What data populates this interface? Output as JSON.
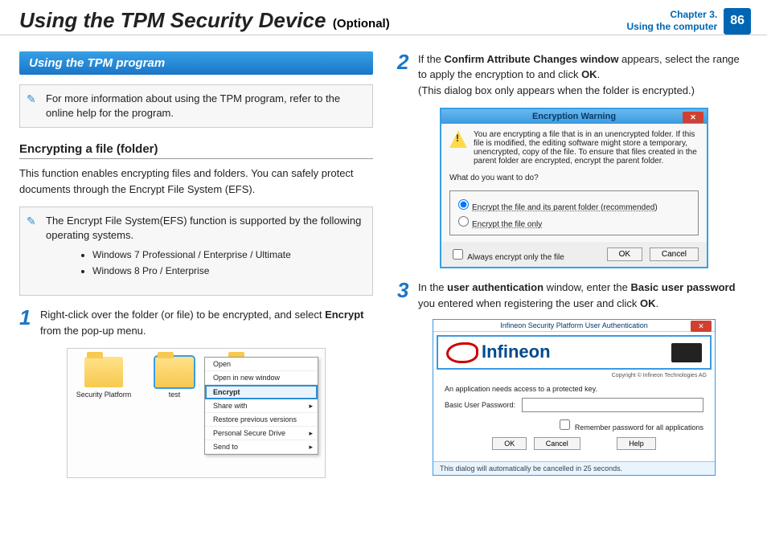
{
  "header": {
    "title_main": "Using the TPM Security Device",
    "title_suffix": "(Optional)",
    "chapter_line1": "Chapter 3.",
    "chapter_line2": "Using the computer",
    "page_number": "86"
  },
  "left": {
    "section_bar": "Using the TPM program",
    "note1": "For more information about using the TPM program, refer to the online help for the program.",
    "subhead": "Encrypting a file (folder)",
    "intro": "This function enables encrypting files and folders. You can safely protect documents through the Encrypt File System (EFS).",
    "note2_intro": "The Encrypt File System(EFS) function is supported by the following operating systems.",
    "note2_items": [
      "Windows 7 Professional / Enterprise / Ultimate",
      "Windows 8 Pro / Enterprise"
    ],
    "step1_num": "1",
    "step1_a": "Right-click over the folder (or file) to be encrypted, and select ",
    "step1_b": "Encrypt",
    "step1_c": " from the pop-up menu.",
    "explorer": {
      "folder1": "Security Platform",
      "folder2": "test",
      "menu": {
        "open": "Open",
        "open_new": "Open in new window",
        "encrypt": "Encrypt",
        "share": "Share with",
        "restore": "Restore previous versions",
        "psd": "Personal Secure Drive",
        "send": "Send to"
      }
    }
  },
  "right": {
    "step2_num": "2",
    "step2_a": "If the ",
    "step2_b": "Confirm Attribute Changes window",
    "step2_c": " appears, select the range to apply the encryption to and click ",
    "step2_d": "OK",
    "step2_e": ".",
    "step2_note": "(This dialog box only appears when the folder is encrypted.)",
    "dlg2": {
      "title": "Encryption Warning",
      "msg": "You are encrypting a file that is in an unencrypted folder. If this file is modified, the editing software might store a temporary, unencrypted, copy of the file. To ensure that files created in the parent folder are encrypted, encrypt the parent folder.",
      "q": "What do you want to do?",
      "opt1": "Encrypt the file and its parent folder (recommended)",
      "opt2": "Encrypt the file only",
      "always": "Always encrypt only the file",
      "ok": "OK",
      "cancel": "Cancel"
    },
    "step3_num": "3",
    "step3_a": "In the ",
    "step3_b": "user authentication",
    "step3_c": " window, enter the ",
    "step3_d": "Basic user password",
    "step3_e": " you entered when registering the user and click ",
    "step3_f": "OK",
    "step3_g": ".",
    "dlg3": {
      "title": "Infineon Security Platform User Authentication",
      "logo": "Infineon",
      "copyright": "Copyright © Infineon Technologies AG",
      "line1": "An application needs access to a protected key.",
      "pw_label": "Basic User Password:",
      "remember": "Remember password for all applications",
      "ok": "OK",
      "cancel": "Cancel",
      "help": "Help",
      "footer": "This dialog will automatically be cancelled in 25 seconds."
    }
  }
}
